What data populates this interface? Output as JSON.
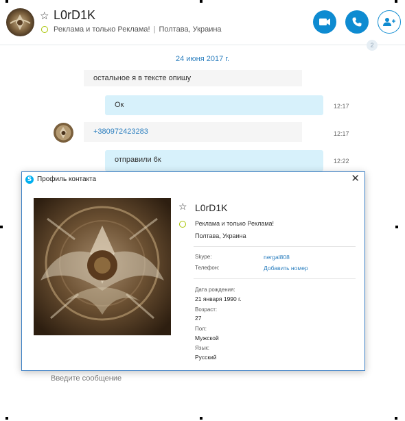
{
  "header": {
    "name": "L0rD1K",
    "mood": "Реклама и только Реклама!",
    "location": "Полтава, Украина",
    "video_icon": "video-camera-icon",
    "call_icon": "phone-icon",
    "add_contact_icon": "add-person-icon"
  },
  "chat": {
    "date": "24 июня 2017 г.",
    "messages": [
      {
        "text": "остальное я в тексте опишу",
        "time": ""
      },
      {
        "text": "Ок",
        "time": "12:17"
      },
      {
        "text": "+380972423283",
        "time": "12:17"
      },
      {
        "text": "отправили 6к",
        "time": "12:22"
      }
    ]
  },
  "compose": {
    "placeholder": "Введите сообщение"
  },
  "profile": {
    "window_title": "Профиль контакта",
    "close_glyph": "✕",
    "name": "L0rD1K",
    "mood": "Реклама и только Реклама!",
    "location": "Полтава, Украина",
    "skype_label": "Skype:",
    "skype_value": "nergal808",
    "phone_label": "Телефон:",
    "phone_action": "Добавить номер",
    "birth_label": "Дата рождения:",
    "birth_value": "21 января 1990 г.",
    "age_label": "Возраст:",
    "age_value": "27",
    "gender_label": "Пол:",
    "gender_value": "Мужской",
    "lang_label": "Язык:",
    "lang_value": "Русский"
  },
  "colors": {
    "accent": "#0e8bd1",
    "bubble_out": "#d7f1fb",
    "status": "#a8c400",
    "link": "#2c7fbf"
  }
}
